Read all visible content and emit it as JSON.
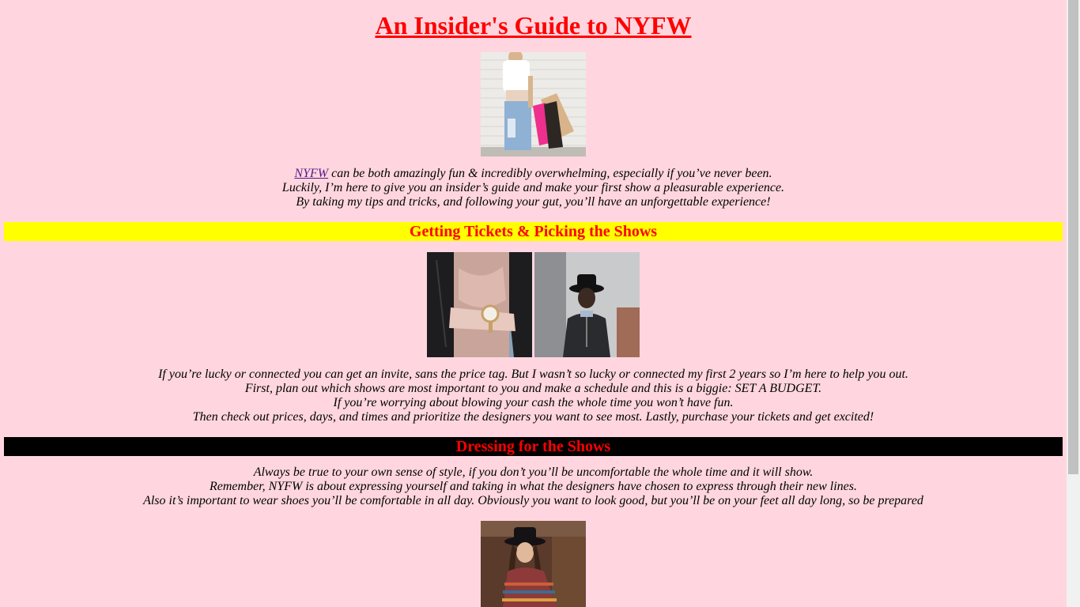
{
  "title": "An Insider's Guide to NYFW",
  "intro": {
    "link_text": "NYFW",
    "line1_rest": " can be both amazingly fun & incredibly overwhelming, especially if you’ve never been.",
    "line2": "Luckily, I’m here to give you an insider’s guide and make your first show a pleasurable experience.",
    "line3": "By taking my tips and tricks, and following your gut, you’ll have an unforgettable experience!"
  },
  "section1": {
    "heading": "Getting Tickets & Picking the Shows",
    "lines": [
      "If you’re lucky or connected you can get an invite, sans the price tag. But I wasn’t so lucky or connected my first 2 years so I’m here to help you out.",
      "First, plan out which shows are most important to you and make a schedule and this is a biggie: SET A BUDGET.",
      "If you’re worrying about blowing your cash the whole time you won’t have fun.",
      "Then check out prices, days, and times and prioritize the designers you want to see most. Lastly, purchase your tickets and get excited!"
    ]
  },
  "section2": {
    "heading": "Dressing for the Shows",
    "lines": [
      "Always be true to your own sense of style, if you don’t you’ll be uncomfortable the whole time and it will show.",
      "Remember, NYFW is about expressing yourself and taking in what the designers have chosen to express through their new lines.",
      "Also it’s important to wear shoes you’ll be comfortable in all day. Obviously you want to look good, but you’ll be on your feet all day long, so be prepared"
    ]
  },
  "colors": {
    "background": "#ffd6df",
    "title": "#ff0000",
    "heading_text": "#ff0000",
    "band1": "#ffff00",
    "band2": "#000000",
    "link": "#551a8b"
  },
  "images": {
    "hero": "photo-woman-shopping-bags",
    "left": "photo-watch-leather-jacket",
    "right": "photo-man-black-hat",
    "bottom": "photo-woman-hat-colorful-coat"
  }
}
